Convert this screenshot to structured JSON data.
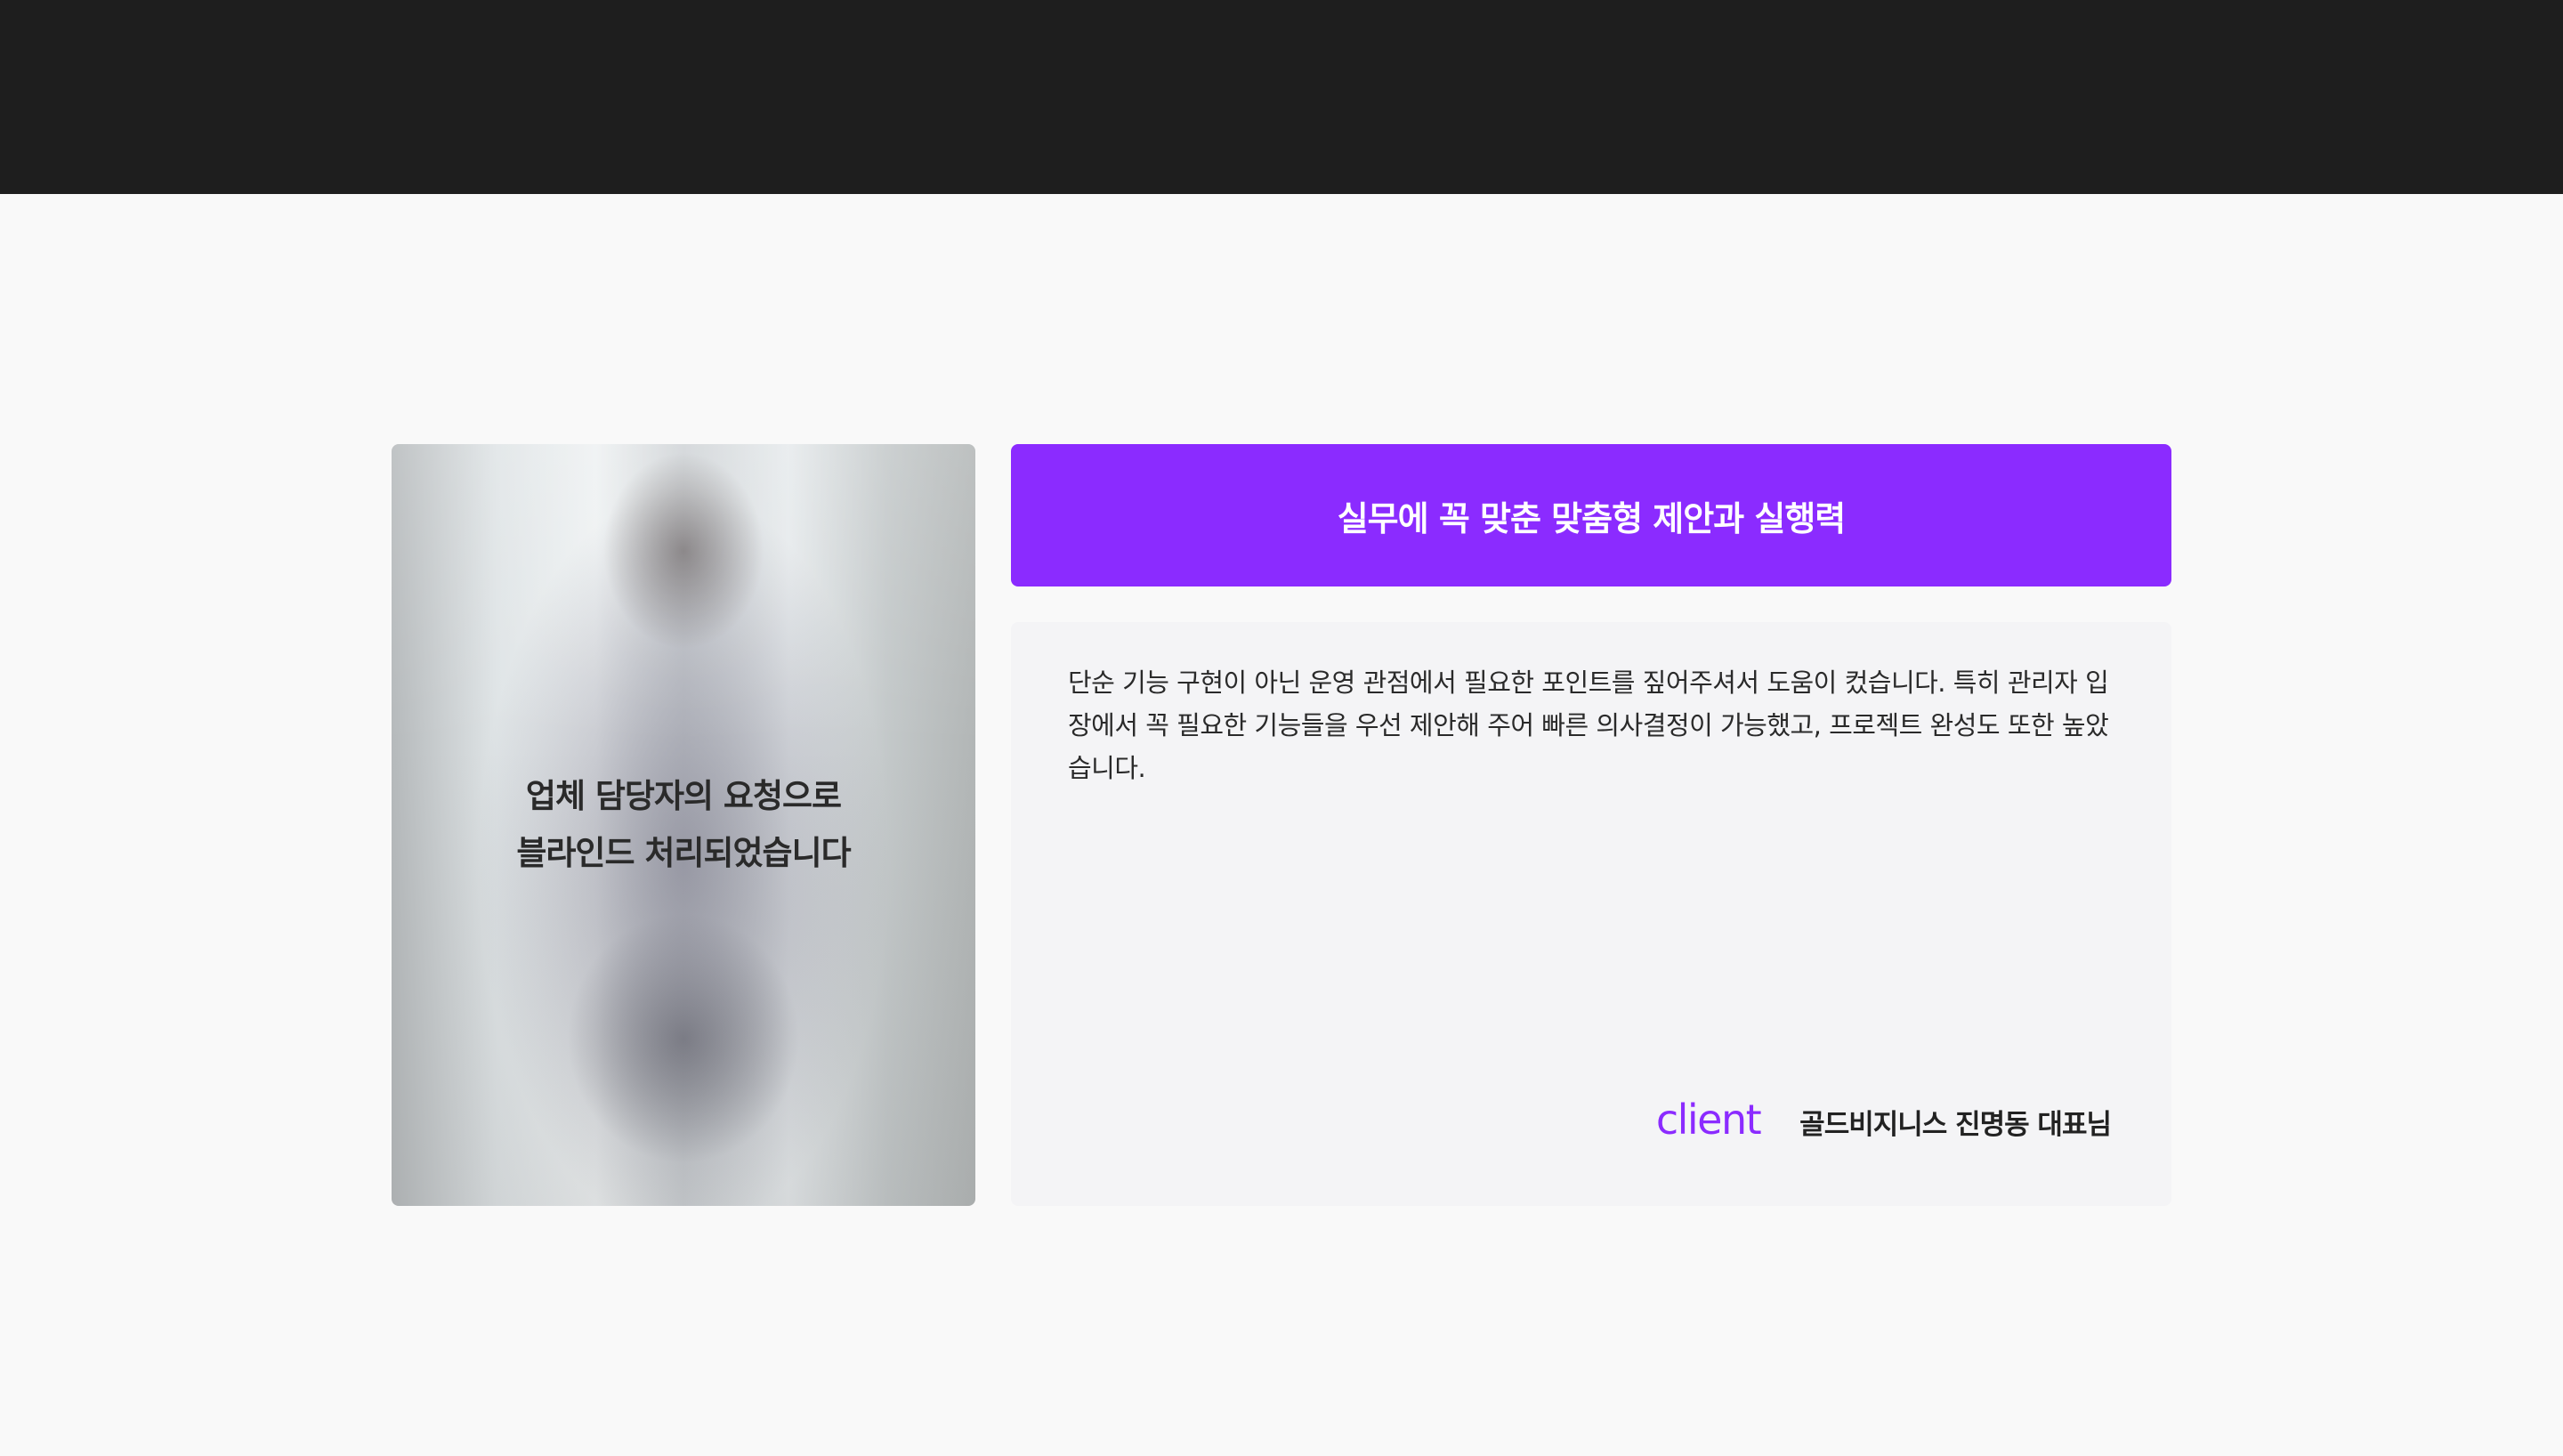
{
  "photo": {
    "overlay_line1": "업체 담당자의 요청으로",
    "overlay_line2": "블라인드 처리되었습니다"
  },
  "review": {
    "headline": "실무에 꼭 맞춘 맞춤형 제안과 실행력",
    "body": "단순 기능 구현이 아닌 운영 관점에서 필요한 포인트를 짚어주셔서 도움이 컸습니다. 특히 관리자 입장에서 꼭 필요한 기능들을 우선 제안해 주어 빠른 의사결정이 가능했고, 프로젝트 완성도 또한 높았습니다.",
    "client_label": "client",
    "client_name": "골드비지니스 진명동 대표님"
  },
  "colors": {
    "accent": "#8b2bff",
    "top_bar": "#1e1e1e",
    "background": "#f9f9f9",
    "card": "#f4f4f6"
  }
}
